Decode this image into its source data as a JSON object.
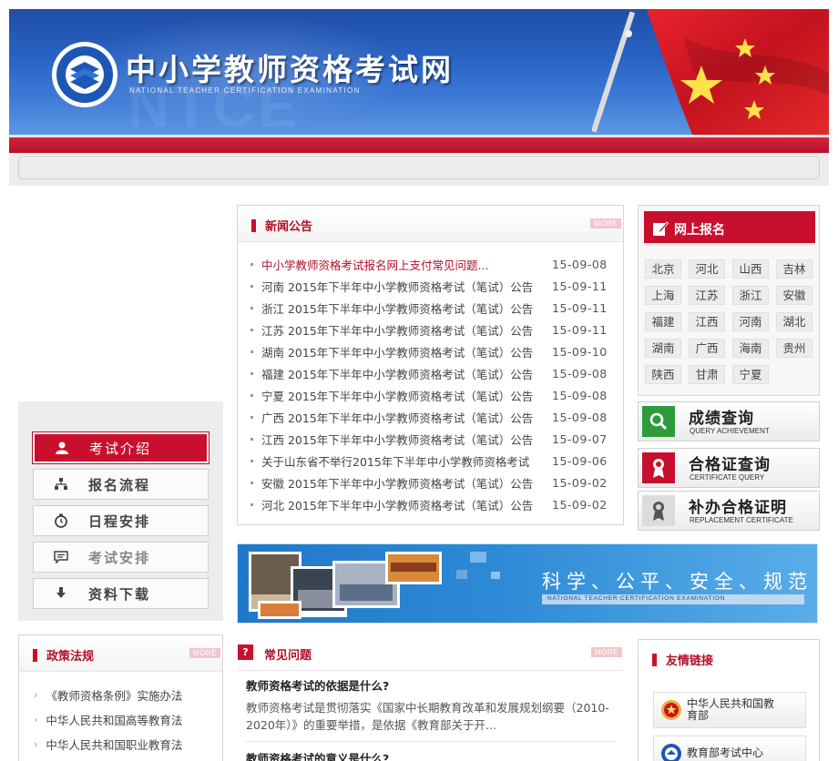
{
  "header": {
    "title": "中小学教师资格考试网",
    "subtitle": "NATIONAL TEACHER CERTIFICATION EXAMINATION"
  },
  "left_menu": {
    "items": [
      {
        "label": "考试介绍",
        "icon": "user-icon",
        "active": true
      },
      {
        "label": "报名流程",
        "icon": "flow-icon",
        "active": false
      },
      {
        "label": "日程安排",
        "icon": "clock-icon",
        "active": false
      },
      {
        "label": "考试安排",
        "icon": "message-icon",
        "active": false
      },
      {
        "label": "资料下载",
        "icon": "download-icon",
        "active": false
      }
    ]
  },
  "news": {
    "title": "新闻公告",
    "more": "MORE",
    "items": [
      {
        "title": "中小学教师资格考试报名网上支付常见问题...",
        "date": "15-09-08",
        "highlight": true
      },
      {
        "title": "河南 2015年下半年中小学教师资格考试（笔试）公告",
        "date": "15-09-11"
      },
      {
        "title": "浙江 2015年下半年中小学教师资格考试（笔试）公告",
        "date": "15-09-11"
      },
      {
        "title": "江苏 2015年下半年中小学教师资格考试（笔试）公告",
        "date": "15-09-11"
      },
      {
        "title": "湖南 2015年下半年中小学教师资格考试（笔试）公告",
        "date": "15-09-10"
      },
      {
        "title": "福建 2015年下半年中小学教师资格考试（笔试）公告",
        "date": "15-09-08"
      },
      {
        "title": "宁夏 2015年下半年中小学教师资格考试（笔试）公告",
        "date": "15-09-08"
      },
      {
        "title": "广西 2015年下半年中小学教师资格考试（笔试）公告",
        "date": "15-09-08"
      },
      {
        "title": "江西 2015年下半年中小学教师资格考试（笔试）公告",
        "date": "15-09-07"
      },
      {
        "title": "关于山东省不举行2015年下半年中小学教师资格考试",
        "date": "15-09-06"
      },
      {
        "title": "安徽 2015年下半年中小学教师资格考试（笔试）公告",
        "date": "15-09-02"
      },
      {
        "title": "河北 2015年下半年中小学教师资格考试（笔试）公告",
        "date": "15-09-02"
      }
    ]
  },
  "registration": {
    "title": "网上报名",
    "provinces": [
      "北京",
      "河北",
      "山西",
      "吉林",
      "上海",
      "江苏",
      "浙江",
      "安徽",
      "福建",
      "江西",
      "河南",
      "湖北",
      "湖南",
      "广西",
      "海南",
      "贵州",
      "陕西",
      "甘肃",
      "宁夏"
    ]
  },
  "services": [
    {
      "title": "成绩查询",
      "subtitle": "QUERY ACHIEVEMENT",
      "icon": "search-icon",
      "color": "#2e9b3c"
    },
    {
      "title": "合格证查询",
      "subtitle": "CERTIFICATE QUERY",
      "icon": "certificate-icon",
      "color": "#c8102e"
    },
    {
      "title": "补办合格证明",
      "subtitle": "REPLACEMENT CERTIFICATE",
      "icon": "certificate-outline-icon",
      "color": "#666666"
    }
  ],
  "mid_banner": {
    "text": "科学、公平、安全、规范",
    "subtext": "NATIONAL TEACHER CERTIFICATION EXAMINATION"
  },
  "policy": {
    "title": "政策法规",
    "more": "MORE",
    "items": [
      "《教师资格条例》实施办法",
      "中华人民共和国高等教育法",
      "中华人民共和国职业教育法"
    ]
  },
  "faq": {
    "title": "常见问题",
    "icon_glyph": "?",
    "more": "MORE",
    "items": [
      {
        "q": "教师资格考试的依据是什么?",
        "a": "教师资格考试是贯彻落实《国家中长期教育改革和发展规划纲要（2010-2020年）》的重要举措，是依据《教育部关于开..."
      },
      {
        "q": "教师资格考试的意义是什么?",
        "a": ""
      }
    ]
  },
  "links": {
    "title": "友情链接",
    "items": [
      "中华人民共和国教育部",
      "教育部考试中心"
    ]
  },
  "colors": {
    "brand_red": "#c8102e",
    "banner_blue": "#2a63c4"
  }
}
